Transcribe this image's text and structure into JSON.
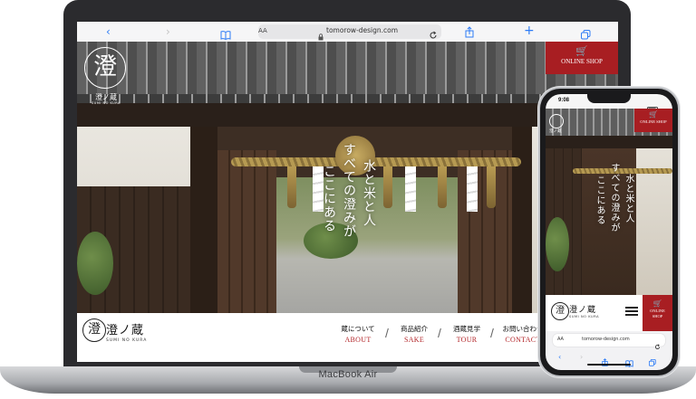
{
  "laptop": {
    "model_label": "MacBook Air",
    "browser": {
      "back_icon": "chevron-left",
      "forward_icon": "chevron-right",
      "reader_text": "AA",
      "url": "tomorow-design.com",
      "reload_icon": "reload",
      "share_icon": "share",
      "add_icon": "plus",
      "tabs_icon": "tabs"
    },
    "hero": {
      "logo_glyph": "澄",
      "logo_name": "澄ノ蔵",
      "logo_roman": "SUMI NO KURA",
      "online_shop_label": "ONLINE SHOP",
      "tagline_columns": [
        "水と米と人",
        "すべての澄みが",
        "ここにある"
      ]
    },
    "footer": {
      "logo_glyph": "澄",
      "site_name": "澄ノ蔵",
      "site_roman": "SUMI NO KURA",
      "nav": [
        {
          "jp": "蔵について",
          "en": "ABOUT"
        },
        {
          "jp": "商品紹介",
          "en": "SAKE"
        },
        {
          "jp": "酒蔵見学",
          "en": "TOUR"
        },
        {
          "jp": "お問い合わせ",
          "en": "CONTACT"
        }
      ],
      "separator": "/"
    }
  },
  "phone": {
    "status_time": "9:08",
    "hero": {
      "logo_name": "澄ノ蔵",
      "online_shop_label": "ONLINE SHOP",
      "tagline_columns": [
        "水と米と人",
        "すべての澄みが",
        "ここにある"
      ]
    },
    "bottom": {
      "logo_glyph": "澄",
      "site_name": "澄ノ蔵",
      "site_roman": "SUMI NO KURA",
      "online_label_1": "ONLINE",
      "online_label_2": "SHOP"
    },
    "browser": {
      "reader_text": "AA",
      "url": "tomorow-design.com"
    }
  },
  "colors": {
    "accent_red": "#a81e22",
    "link_blue": "#2e7cf6"
  }
}
